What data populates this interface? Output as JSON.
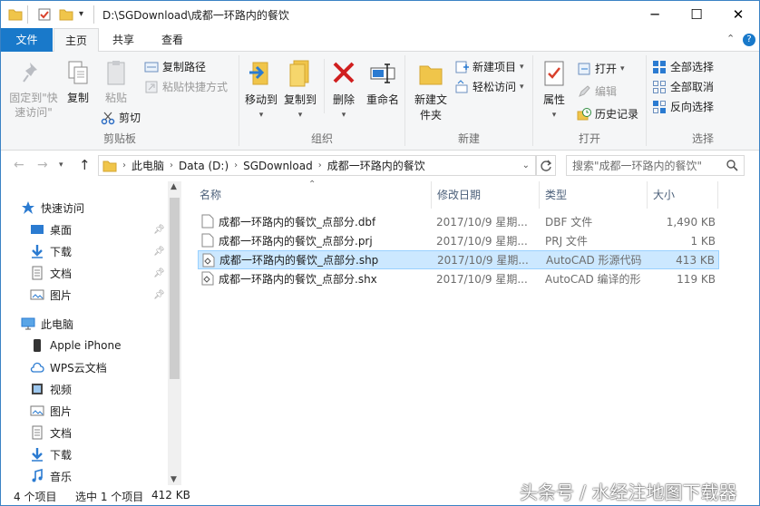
{
  "window": {
    "title": "D:\\SGDownload\\成都一环路内的餐饮",
    "controls": {
      "minimize": "─",
      "maximize": "☐",
      "close": "✕"
    }
  },
  "tabs": {
    "file": "文件",
    "home": "主页",
    "share": "共享",
    "view": "查看",
    "expand": "⌃",
    "help": "?"
  },
  "ribbon": {
    "clipboard": {
      "label": "剪贴板",
      "pin_quick": "固定到\"快速访问\"",
      "copy": "复制",
      "paste": "粘贴",
      "copy_path": "复制路径",
      "paste_shortcut": "粘贴快捷方式",
      "cut": "剪切"
    },
    "organize": {
      "label": "组织",
      "move_to": "移动到",
      "copy_to": "复制到",
      "delete": "删除",
      "rename": "重命名"
    },
    "new": {
      "label": "新建",
      "new_folder": "新建文件夹",
      "new_item": "新建项目",
      "easy_access": "轻松访问"
    },
    "open": {
      "label": "打开",
      "properties": "属性",
      "open": "打开",
      "edit": "编辑",
      "history": "历史记录"
    },
    "select": {
      "label": "选择",
      "select_all": "全部选择",
      "select_none": "全部取消",
      "invert": "反向选择"
    }
  },
  "nav": {
    "back": "←",
    "forward": "→",
    "up": "↑",
    "breadcrumb": [
      "此电脑",
      "Data (D:)",
      "SGDownload",
      "成都一环路内的餐饮"
    ],
    "search_placeholder": "搜索\"成都一环路内的餐饮\""
  },
  "sidebar": {
    "quick_access": "快速访问",
    "quick_items": [
      "桌面",
      "下载",
      "文档",
      "图片"
    ],
    "this_pc": "此电脑",
    "pc_items": [
      "Apple iPhone",
      "WPS云文档",
      "视频",
      "图片",
      "文档",
      "下载",
      "音乐"
    ]
  },
  "columns": {
    "name": "名称",
    "date": "修改日期",
    "type": "类型",
    "size": "大小"
  },
  "files": [
    {
      "name": "成都一环路内的餐饮_点部分.dbf",
      "date": "2017/10/9 星期...",
      "type": "DBF 文件",
      "size": "1,490 KB",
      "selected": false
    },
    {
      "name": "成都一环路内的餐饮_点部分.prj",
      "date": "2017/10/9 星期...",
      "type": "PRJ 文件",
      "size": "1 KB",
      "selected": false
    },
    {
      "name": "成都一环路内的餐饮_点部分.shp",
      "date": "2017/10/9 星期...",
      "type": "AutoCAD 形源代码",
      "size": "413 KB",
      "selected": true
    },
    {
      "name": "成都一环路内的餐饮_点部分.shx",
      "date": "2017/10/9 星期...",
      "type": "AutoCAD 编译的形",
      "size": "119 KB",
      "selected": false
    }
  ],
  "status": {
    "count": "4 个项目",
    "selected": "选中 1 个项目",
    "size": "412 KB"
  },
  "watermark": "头条号 / 水经注地图下载器",
  "colors": {
    "accent": "#1979ca",
    "selection": "#cce8ff",
    "selection_border": "#99d1ff"
  }
}
